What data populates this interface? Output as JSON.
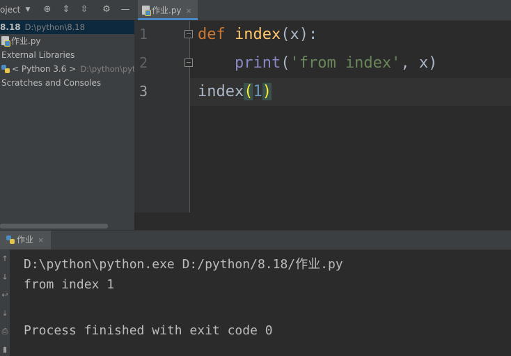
{
  "project_panel": {
    "title": "oject",
    "items": [
      {
        "name": "8.18",
        "path": "D:\\python\\8.18"
      },
      {
        "name": "作业.py"
      },
      {
        "name": "External Libraries"
      },
      {
        "name": "< Python 3.6 >",
        "path": "D:\\python\\pyth"
      },
      {
        "name": "Scratches and Consoles"
      }
    ]
  },
  "editor": {
    "tab": {
      "label": "作业.py",
      "close": "×"
    },
    "line_numbers": [
      "1",
      "2",
      "3"
    ],
    "code": {
      "l1": {
        "kw": "def",
        "fn": "index",
        "rest": "(x):"
      },
      "l2": {
        "indent": "    ",
        "bi": "print",
        "open": "(",
        "str": "'from index'",
        "rest": ", x)"
      },
      "l3": {
        "name": "index",
        "open": "(",
        "num": "1",
        "close": ")"
      }
    }
  },
  "run_panel": {
    "tab": {
      "label": "作业",
      "close": "×"
    },
    "output": [
      "D:\\python\\python.exe D:/python/8.18/作业.py",
      "from index 1",
      "",
      "Process finished with exit code 0"
    ]
  },
  "colors": {
    "background": "#2b2b2b",
    "panel": "#3c3f41",
    "keyword": "#cc7832",
    "function": "#ffc66d",
    "string": "#6a8759",
    "number": "#6897bb",
    "builtin": "#8888c6"
  }
}
